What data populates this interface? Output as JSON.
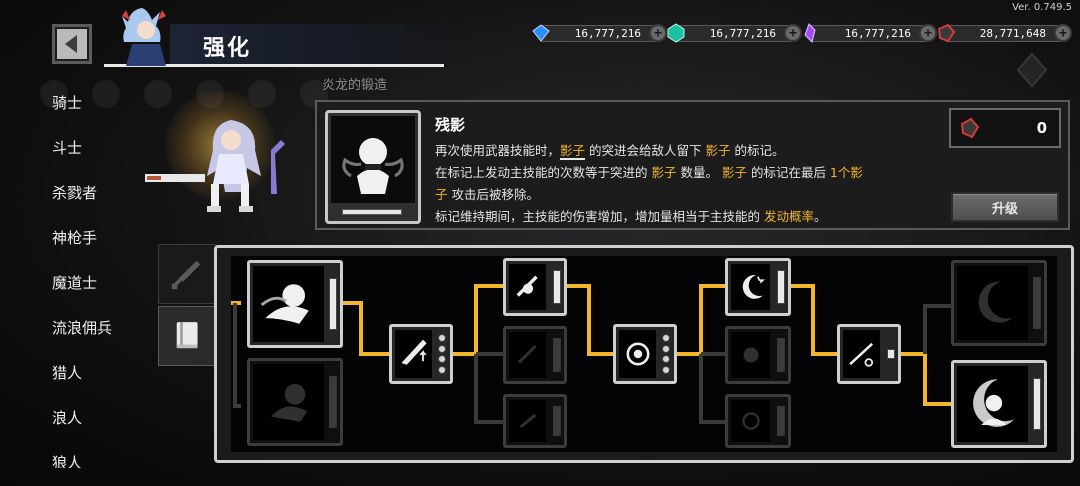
{
  "version": "Ver. 0.749.5",
  "header": {
    "title": "强化",
    "sub_tab": "炎龙的锻造"
  },
  "currencies": [
    {
      "name": "blue-gem",
      "value": "16,777,216",
      "color": "#2d8cff"
    },
    {
      "name": "teal-gem",
      "value": "16,777,216",
      "color": "#19c3a0"
    },
    {
      "name": "purple-crystal",
      "value": "16,777,216",
      "color": "#a34dff"
    },
    {
      "name": "red-ore",
      "value": "28,771,648",
      "color": "#d23b3b"
    }
  ],
  "classes": [
    "骑士",
    "斗士",
    "杀戮者",
    "神枪手",
    "魔道士",
    "流浪佣兵",
    "猎人",
    "浪人",
    "狼人"
  ],
  "skill": {
    "name": "残影",
    "cost": "0",
    "upgrade_label": "升级",
    "desc": {
      "l1a": "再次使用武器技能时，",
      "l1b": "影子",
      "l1c": " 的突进会给敌人留下 ",
      "l1d": "影子",
      "l1e": " 的标记。",
      "l2a": "在标记上发动主技能的次数等于突进的 ",
      "l2b": "影子",
      "l2c": " 数量。 ",
      "l2d": "影子",
      "l2e": " 的标记在最后 ",
      "l2f": "1个影",
      "l3a": "子",
      "l3b": " 攻击后被移除。",
      "l4a": "标记维持期间，主技能的伤害增加，增加量相当于主技能的 ",
      "l4b": "发动概率",
      "l4c": "。"
    }
  },
  "colors": {
    "accent": "#f2b62a",
    "tree_line": "#f2b62a"
  }
}
